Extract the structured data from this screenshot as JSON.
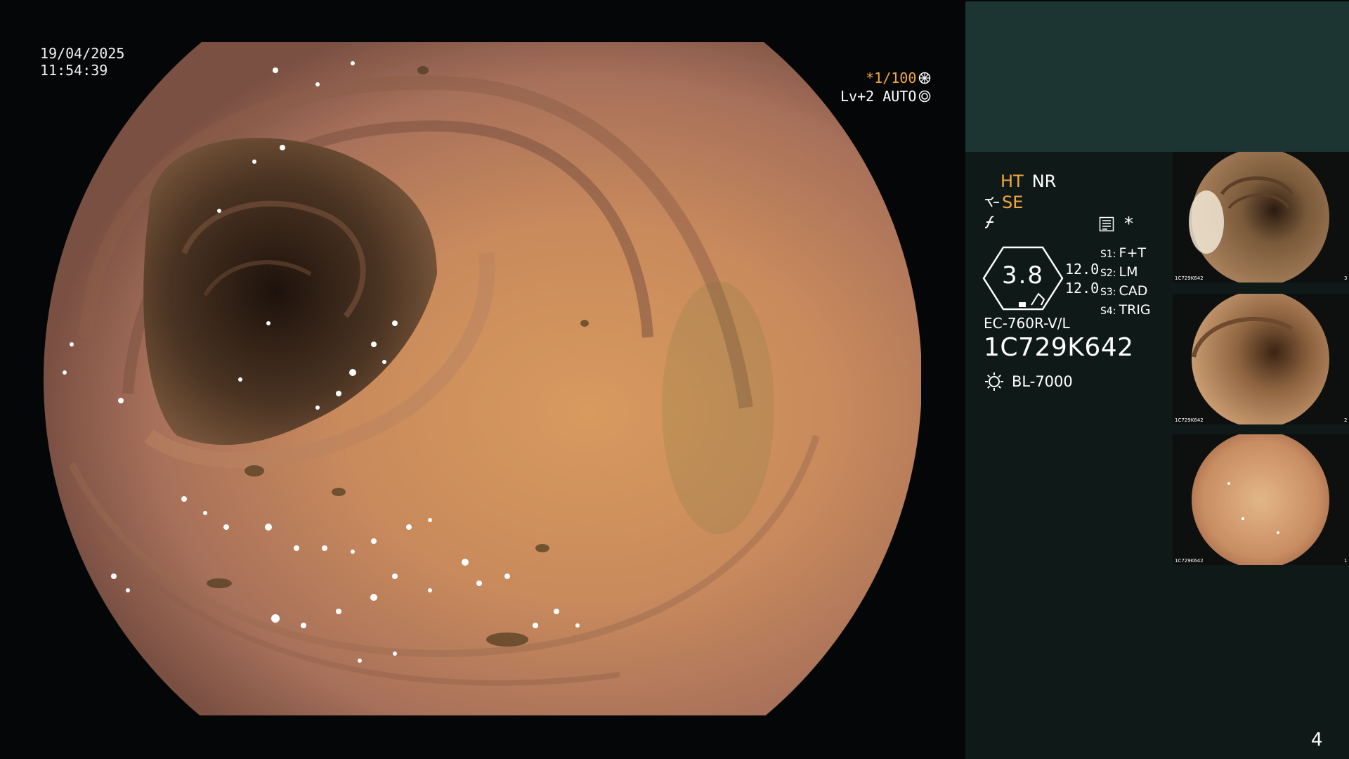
{
  "overlay": {
    "date": "19/04/2025",
    "time": "11:54:39",
    "shutter": "*1/100",
    "level": "Lv+2 AUTO"
  },
  "panel": {
    "ht_label": "HT",
    "nr_label": "NR",
    "se_label": "SE",
    "meter_value": "3.8",
    "ratio_1": "12.0",
    "ratio_2": "12.0",
    "switches": [
      {
        "key": "S1:",
        "value": "F+T"
      },
      {
        "key": "S2:",
        "value": "LM"
      },
      {
        "key": "S3:",
        "value": "CAD"
      },
      {
        "key": "S4:",
        "value": "TRIG"
      }
    ],
    "scope_model": "EC-760R-V/L",
    "scope_serial": "1C729K642",
    "light_source": "BL-7000",
    "star": "*"
  },
  "thumbnails": [
    {
      "label": "1C729K642",
      "index": "3"
    },
    {
      "label": "1C729K642",
      "index": "2"
    },
    {
      "label": "1C729K642",
      "index": "1"
    }
  ],
  "page_number": "4",
  "colors": {
    "accent_orange": "#f3a73b",
    "panel_top": "#1c3533",
    "panel_main": "#0f1a18",
    "background": "#050607"
  },
  "icons": [
    "shutter-wheel-icon",
    "auto-iris-icon",
    "structure-enhancement-icon",
    "edge-enhancement-icon",
    "record-icon",
    "light-source-icon"
  ]
}
